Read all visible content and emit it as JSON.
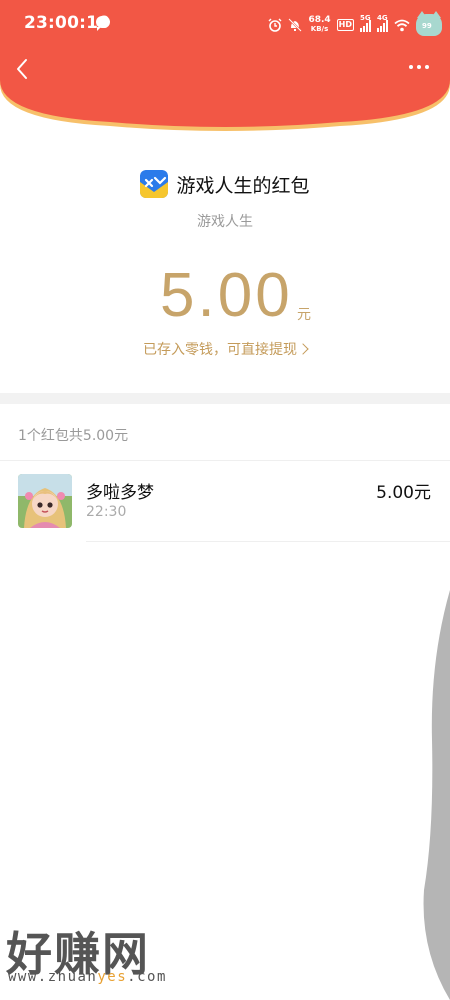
{
  "status_bar": {
    "time": "23:00:10",
    "net_speed": "68.4",
    "net_speed_unit": "KB/s",
    "hd_label": "HD",
    "sim1_label": "5G",
    "sim2_label": "4G",
    "badge": "99"
  },
  "header": {
    "color": "#f25745",
    "back_icon": "chevron-left-icon",
    "more_icon": "more-dots-icon"
  },
  "packet": {
    "title": "游戏人生的红包",
    "sender": "游戏人生",
    "amount": "5.00",
    "unit": "元",
    "saved_note": "已存入零钱，可直接提现",
    "accent_color": "#c7a46a"
  },
  "summary": {
    "text": "1个红包共5.00元"
  },
  "receivers": [
    {
      "name": "多啦多梦",
      "time": "22:30",
      "amount": "5.00元"
    }
  ],
  "watermark": {
    "big": "好赚网",
    "url_prefix": "www.zhuan",
    "url_highlight": "yes",
    "url_suffix": ".com"
  }
}
